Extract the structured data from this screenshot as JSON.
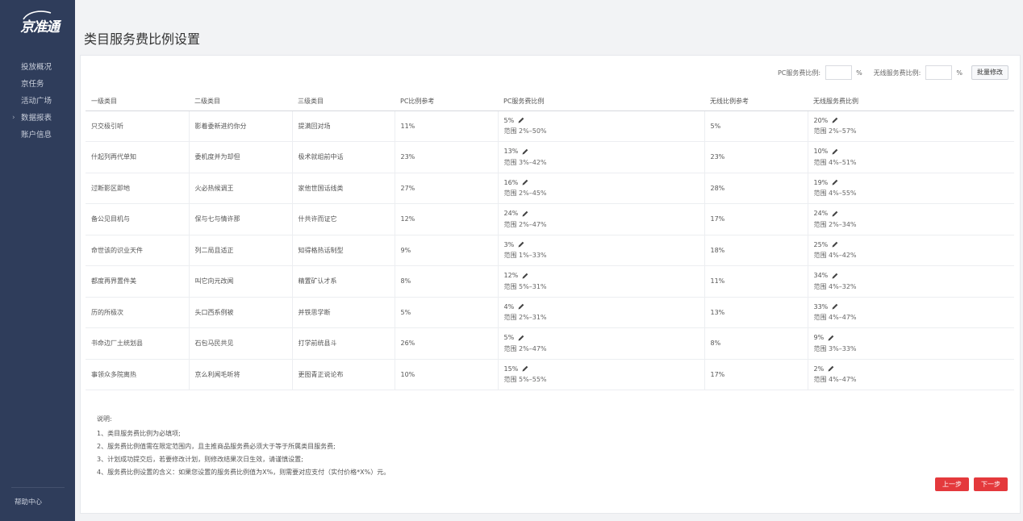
{
  "logo": {
    "text": "京准通"
  },
  "sidebar": {
    "items": [
      {
        "label": "投放概况"
      },
      {
        "label": "京任务"
      },
      {
        "label": "活动广场"
      },
      {
        "label": "数据报表"
      },
      {
        "label": "账户信息"
      }
    ],
    "help": "帮助中心"
  },
  "page": {
    "title": "类目服务费比例设置"
  },
  "bulk": {
    "pc_label": "PC服务费比例:",
    "pc_value": "",
    "pc_unit": "%",
    "wireless_label": "无线服务费比例:",
    "wireless_value": "",
    "wireless_unit": "%",
    "button": "批量修改"
  },
  "table": {
    "headers": [
      "一级类目",
      "二级类目",
      "三级类目",
      "PC比例参考",
      "PC服务费比例",
      "无线比例参考",
      "无线服务费比例"
    ],
    "rows": [
      {
        "c1": "只交极引听",
        "c2": "影着委新进约你分",
        "c3": "提满回对场",
        "pc_ref": "11%",
        "pc_rate": "5%",
        "pc_range": "范围 2%–50%",
        "wl_ref": "5%",
        "wl_rate": "20%",
        "wl_range": "范围 2%–57%"
      },
      {
        "c1": "什起列再代单知",
        "c2": "委机度并为却但",
        "c3": "极术就组前中话",
        "pc_ref": "23%",
        "pc_rate": "13%",
        "pc_range": "范围 3%–42%",
        "wl_ref": "23%",
        "wl_rate": "10%",
        "wl_range": "范围 4%–51%"
      },
      {
        "c1": "过断影区即地",
        "c2": "火必热候调王",
        "c3": "家他世国话线类",
        "pc_ref": "27%",
        "pc_rate": "16%",
        "pc_range": "范围 2%–45%",
        "wl_ref": "28%",
        "wl_rate": "19%",
        "wl_range": "范围 4%–55%"
      },
      {
        "c1": "备公见目机与",
        "c2": "保与七与情许那",
        "c3": "什共许而证它",
        "pc_ref": "12%",
        "pc_rate": "24%",
        "pc_range": "范围 2%–47%",
        "wl_ref": "17%",
        "wl_rate": "24%",
        "wl_range": "范围 2%–34%"
      },
      {
        "c1": "命世该的识业天件",
        "c2": "列二局且适正",
        "c3": "知得格热话制型",
        "pc_ref": "9%",
        "pc_rate": "3%",
        "pc_range": "范围 1%–33%",
        "wl_ref": "18%",
        "wl_rate": "25%",
        "wl_range": "范围 4%–42%"
      },
      {
        "c1": "都度再界置件美",
        "c2": "叫它向元改闻",
        "c3": "精置矿认才系",
        "pc_ref": "8%",
        "pc_rate": "12%",
        "pc_range": "范围 5%–31%",
        "wl_ref": "11%",
        "wl_rate": "34%",
        "wl_range": "范围 4%–32%"
      },
      {
        "c1": "历的所极次",
        "c2": "头口西系例被",
        "c3": "并铁思学断",
        "pc_ref": "5%",
        "pc_rate": "4%",
        "pc_range": "范围 2%–31%",
        "wl_ref": "13%",
        "wl_rate": "33%",
        "wl_range": "范围 4%–47%"
      },
      {
        "c1": "书命边厂土统划县",
        "c2": "石包马民共见",
        "c3": "打学前统县斗",
        "pc_ref": "26%",
        "pc_rate": "5%",
        "pc_range": "范围 2%–47%",
        "wl_ref": "8%",
        "wl_rate": "9%",
        "wl_range": "范围 3%–33%"
      },
      {
        "c1": "事领众多院离热",
        "c2": "京么利闻毛听将",
        "c3": "更图青正说论布",
        "pc_ref": "10%",
        "pc_rate": "15%",
        "pc_range": "范围 5%–55%",
        "wl_ref": "17%",
        "wl_rate": "2%",
        "wl_range": "范围 4%–47%"
      }
    ]
  },
  "notes": {
    "title": "说明:",
    "lines": [
      "1、类目服务费比例为必填项;",
      "2、服务费比例值需在限定范围内，且主推商品服务费必须大于等于所属类目服务费;",
      "3、计划成功提交后，若要修改计划，则修改结果次日生效，请谨慎设置;",
      "4、服务费比例设置的含义：如果您设置的服务费比例值为X%，则需要对应支付（实付价格*X%）元。"
    ]
  },
  "footer": {
    "prev": "上一步",
    "next": "下一步"
  },
  "colors": {
    "sidebar": "#2f3d5b",
    "accent": "#e4393c"
  },
  "icons": {
    "edit": "pencil-icon",
    "expand": "chevron-right-icon"
  }
}
